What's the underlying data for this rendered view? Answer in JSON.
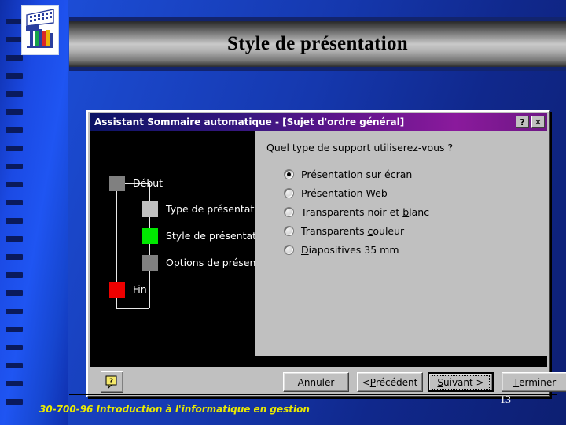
{
  "slide": {
    "title": "Style de présentation",
    "footer_text": "30-700-96 Introduction à l'informatique en gestion",
    "page_number": "13",
    "logo_name": "podium-books-logo"
  },
  "colors": {
    "background_blue": "#1538ae",
    "banner_blue": "#12246e",
    "titlebar_purple": "#8a1a9c",
    "dialog_face": "#c0c0c0",
    "footer_yellow": "#eaea00",
    "step_current_green": "#00e800",
    "step_end_red": "#ee0000",
    "step_gray": "#808080",
    "step_light_gray": "#c0c0c0"
  },
  "dialog": {
    "titlebar": {
      "title": "Assistant Sommaire automatique - [Sujet d'ordre général]",
      "help_label": "?",
      "close_label": "✕"
    },
    "flowchart": {
      "steps": [
        {
          "label": "Début",
          "state": "gray"
        },
        {
          "label": "Type de présentation",
          "state": "ltgray"
        },
        {
          "label": "Style de présentation",
          "state": "green"
        },
        {
          "label": "Options de présentation",
          "state": "gray"
        },
        {
          "label": "Fin",
          "state": "red"
        }
      ]
    },
    "question": "Quel type de support utiliserez-vous ?",
    "options": [
      {
        "pre": "Pr",
        "accel": "é",
        "post": "sentation sur écran",
        "selected": true
      },
      {
        "pre": "Présentation ",
        "accel": "W",
        "post": "eb",
        "selected": false
      },
      {
        "pre": "Transparents noir et ",
        "accel": "b",
        "post": "lanc",
        "selected": false
      },
      {
        "pre": "Transparents ",
        "accel": "c",
        "post": "ouleur",
        "selected": false
      },
      {
        "pre": "",
        "accel": "D",
        "post": "iapositives 35 mm",
        "selected": false
      }
    ],
    "buttons": {
      "help": "?",
      "cancel": "Annuler",
      "back_pre": "< ",
      "back_accel": "P",
      "back_post": "récédent",
      "next_pre": "",
      "next_accel": "S",
      "next_post": "uivant >",
      "finish_pre": "",
      "finish_accel": "T",
      "finish_post": "erminer"
    }
  }
}
